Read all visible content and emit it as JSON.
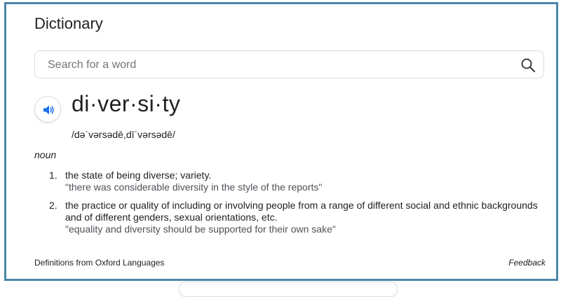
{
  "panel": {
    "title": "Dictionary"
  },
  "search": {
    "placeholder": "Search for a word",
    "value": "",
    "button_icon": "search-icon"
  },
  "entry": {
    "speaker_icon": "speaker-icon",
    "headword": "di·ver·si·ty",
    "phonetic": "/dəˈvərsədē,dīˈvərsədē/",
    "part_of_speech": "noun",
    "definitions": [
      {
        "number": "1.",
        "text": "the state of being diverse; variety.",
        "example": "\"there was considerable diversity in the style of the reports\""
      },
      {
        "number": "2.",
        "text": "the practice or quality of including or involving people from a range of different social and ethnic backgrounds and of different genders, sexual orientations, etc.",
        "example": "\"equality and diversity should be supported for their own sake\""
      }
    ]
  },
  "footer": {
    "source": "Definitions from Oxford Languages",
    "feedback": "Feedback"
  },
  "colors": {
    "frame_border": "#4b87a9",
    "speaker_blue": "#1a73e8",
    "text": "#202124",
    "example_text": "#4d5156"
  }
}
